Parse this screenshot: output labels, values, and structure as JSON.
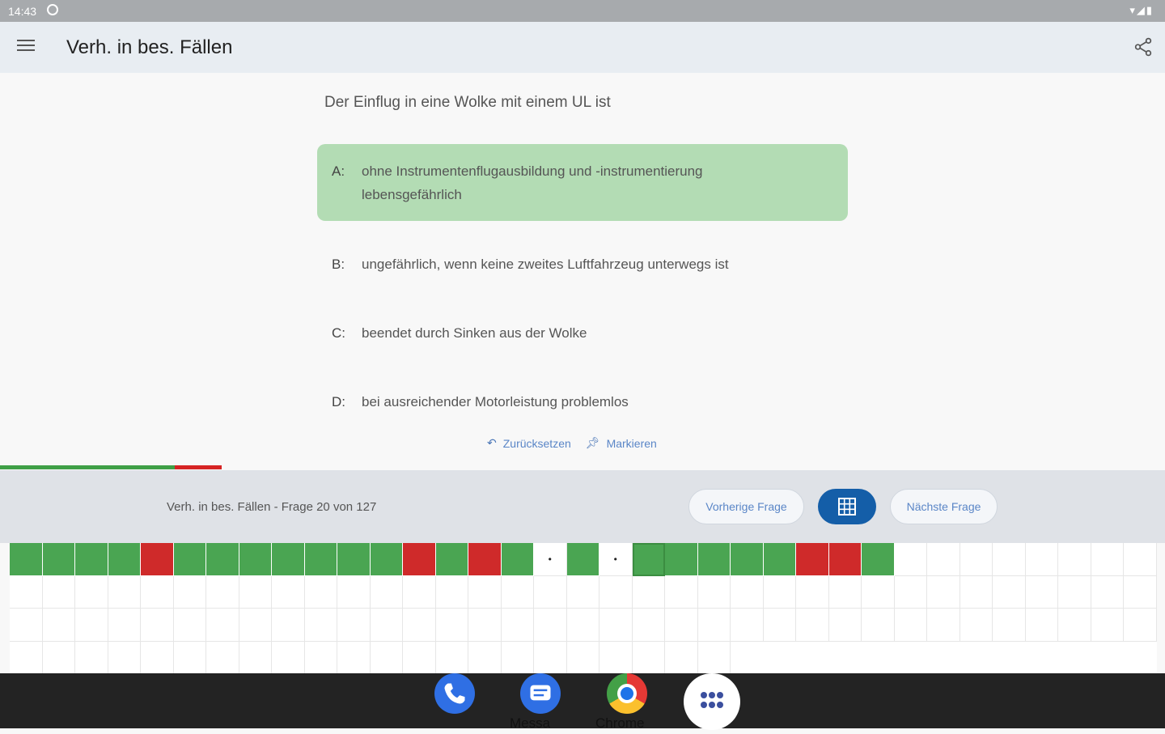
{
  "status_bar": {
    "time": "14:43"
  },
  "app_bar": {
    "title": "Verh. in bes. Fällen"
  },
  "question": {
    "text": "Der Einflug in eine Wolke mit einem UL ist"
  },
  "answers": [
    {
      "letter": "A:",
      "text": "ohne Instrumentenflugausbildung und -instrumentierung lebensgefährlich",
      "state": "correct"
    },
    {
      "letter": "B:",
      "text": "ungefährlich, wenn keine zweites Luftfahrzeug unterwegs ist",
      "state": "neutral"
    },
    {
      "letter": "C:",
      "text": "beendet durch Sinken aus der Wolke",
      "state": "neutral"
    },
    {
      "letter": "D:",
      "text": "bei ausreichender Motorleistung problemlos",
      "state": "neutral"
    }
  ],
  "actions": {
    "reset_label": "Zurücksetzen",
    "mark_label": "Markieren"
  },
  "progress": {
    "green_fraction": 0.15,
    "red_fraction": 0.04
  },
  "nav": {
    "info": "Verh. in bes. Fällen - Frage 20 von 127",
    "prev_label": "Vorherige Frage",
    "next_label": "Nächste Frage"
  },
  "question_grid": {
    "total": 127,
    "current": 20,
    "statuses": [
      "g",
      "g",
      "g",
      "g",
      "r",
      "g",
      "g",
      "g",
      "g",
      "g",
      "g",
      "g",
      "r",
      "g",
      "r",
      "g",
      "m",
      "g",
      "m",
      "g",
      "g",
      "g",
      "g",
      "g",
      "r",
      "r",
      "g"
    ]
  },
  "dock": {
    "messages_label": "Messa",
    "chrome_label": "Chrome"
  },
  "colors": {
    "correct": "#b3dcb4",
    "green": "#4aa552",
    "red": "#cf2a2a",
    "accent": "#145ea8"
  }
}
